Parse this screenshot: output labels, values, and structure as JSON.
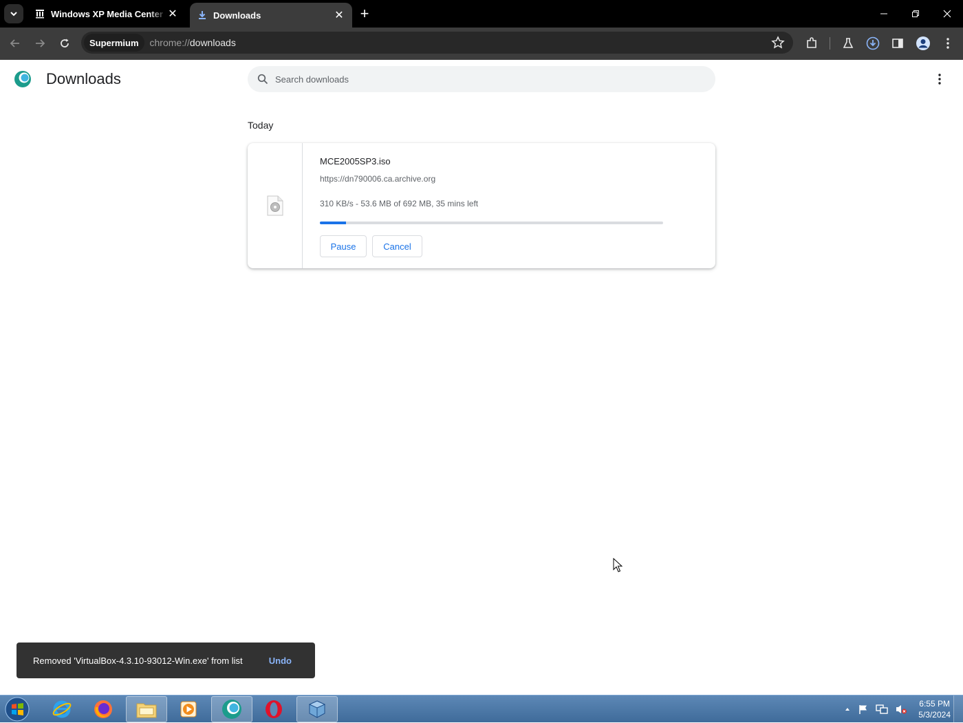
{
  "tabs": [
    {
      "title": "Windows XP Media Center Edition",
      "icon": "archive-icon",
      "active": false
    },
    {
      "title": "Downloads",
      "icon": "download-icon",
      "active": true
    }
  ],
  "toolbar": {
    "chip_label": "Supermium",
    "url_scheme": "chrome://",
    "url_host": "downloads"
  },
  "page": {
    "title": "Downloads",
    "search_placeholder": "Search downloads",
    "section_date": "Today"
  },
  "download": {
    "filename": "MCE2005SP3.iso",
    "url": "https://dn790006.ca.archive.org",
    "status": "310 KB/s - 53.6 MB of 692 MB, 35 mins left",
    "progress_percent": 7.7,
    "pause_label": "Pause",
    "cancel_label": "Cancel"
  },
  "toast": {
    "message": "Removed 'VirtualBox-4.3.10-93012-Win.exe' from list",
    "action_label": "Undo"
  },
  "taskbar": {
    "items": [
      "internet-explorer-icon",
      "firefox-icon",
      "file-explorer-icon",
      "media-player-icon",
      "supermium-icon",
      "opera-icon",
      "virtualbox-icon"
    ],
    "time": "6:55 PM",
    "date": "5/3/2024"
  },
  "colors": {
    "accent": "#1a73e8",
    "undo": "#8ab4f8",
    "toolbar": "#3c3c3c",
    "titlebar": "#000000"
  }
}
